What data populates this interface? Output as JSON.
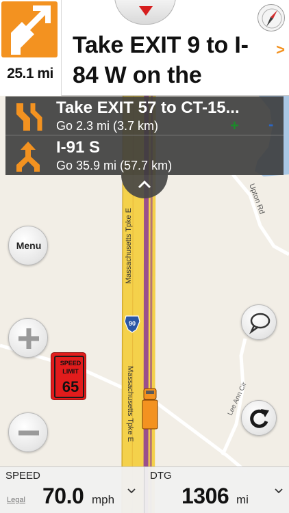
{
  "instruction": {
    "distance": "25.1 mi",
    "text": "Take EXIT 9 to I-84 W on the",
    "next_glyph": ">",
    "turn_icon": "bear-right-arrow-icon",
    "accent_color": "#f39220"
  },
  "upcoming": [
    {
      "title": "Take EXIT 57 to CT-15...",
      "detail": "Go 2.3 mi  (3.7 km)",
      "icon": "exit-left-arrow-icon"
    },
    {
      "title": "I-91 S",
      "detail": "Go 35.9 mi  (57.7 km)",
      "icon": "fork-arrow-icon"
    }
  ],
  "controls": {
    "menu_label": "Menu",
    "zoom_in_glyph": "+",
    "zoom_out_glyph": "-"
  },
  "speed_limit": {
    "line1": "SPEED",
    "line2": "LIMIT",
    "value": "65",
    "color": "#e21c1c"
  },
  "map": {
    "road_label_1": "Massachusetts Tpke E",
    "road_label_2": "Massachusetts Tpke E",
    "shield": "90",
    "upton_rd": "Upton Rd",
    "lee_ann_cir": "Lee Ann Cir"
  },
  "status": {
    "speed_label": "SPEED",
    "speed_value": "70.0",
    "speed_unit": "mph",
    "dtg_label": "DTG",
    "dtg_value": "1306",
    "dtg_unit": "mi",
    "legal": "Legal"
  }
}
